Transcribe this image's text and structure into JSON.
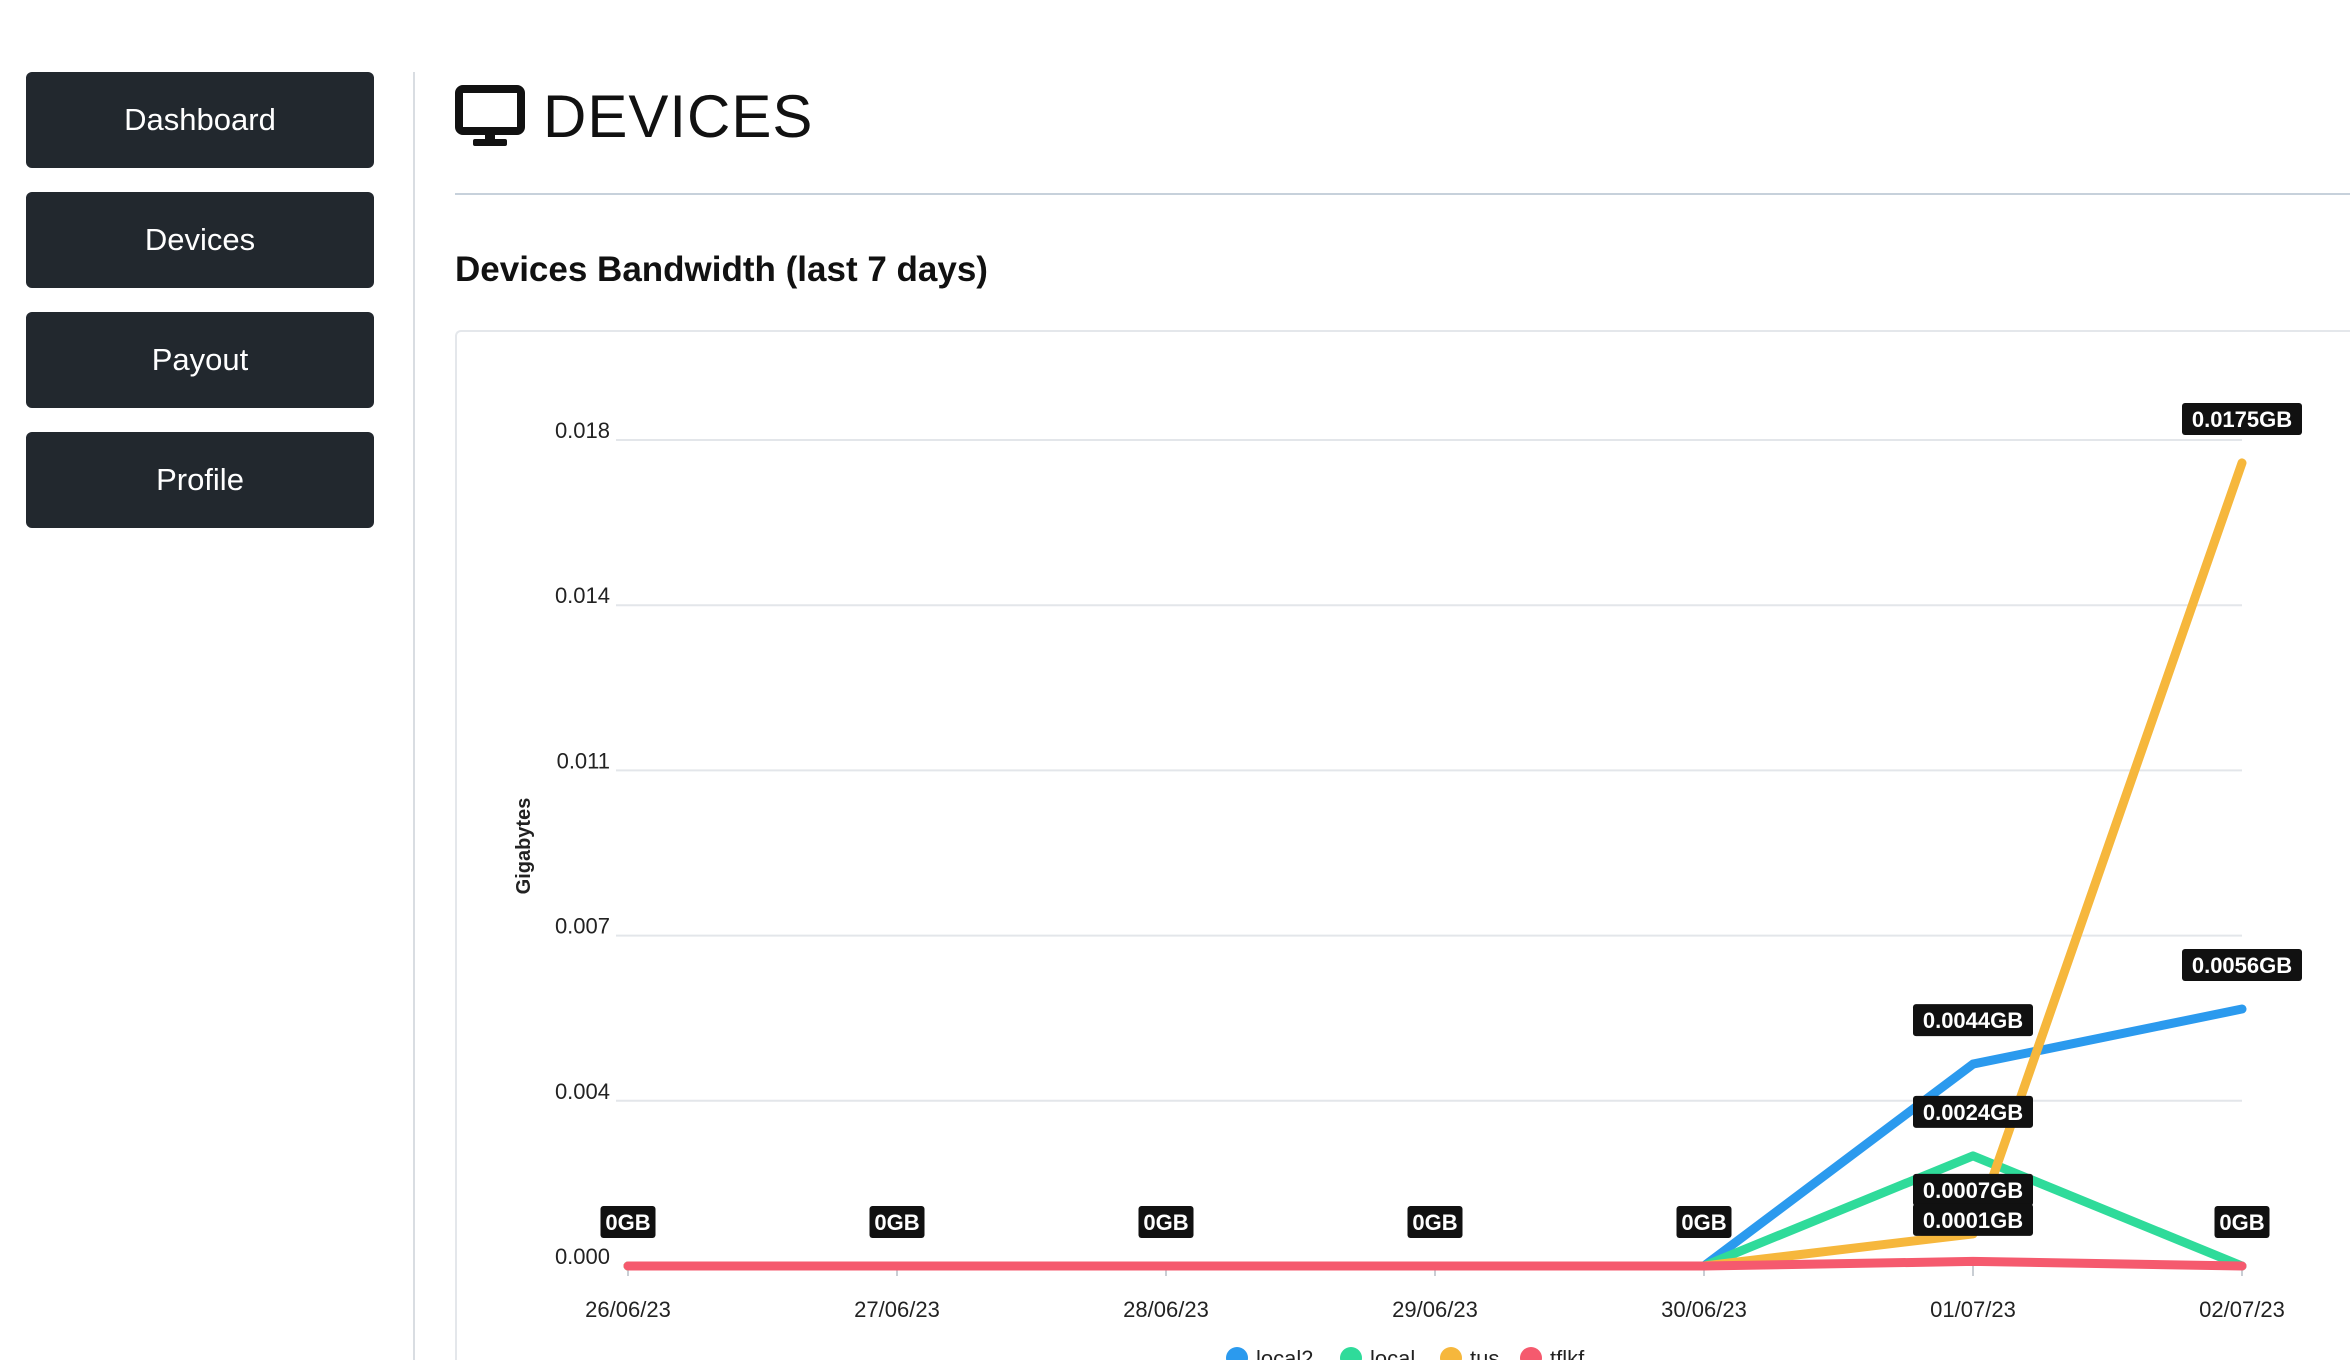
{
  "sidebar": {
    "items": [
      {
        "label": "Dashboard"
      },
      {
        "label": "Devices"
      },
      {
        "label": "Payout"
      },
      {
        "label": "Profile"
      }
    ]
  },
  "header": {
    "title": "DEVICES",
    "icon": "monitor-icon"
  },
  "section": {
    "title": "Devices Bandwidth (last 7 days)"
  },
  "colors": {
    "sidebar_button_bg": "#22282e",
    "sidebar_button_text": "#ffffff",
    "data_label_bg": "#111111"
  },
  "chart_data": {
    "type": "line",
    "ylabel": "Gigabytes",
    "ylim": [
      0,
      0.018
    ],
    "y_ticks": [
      "0.000",
      "0.004",
      "0.007",
      "0.011",
      "0.014",
      "0.018"
    ],
    "categories": [
      "26/06/23",
      "27/06/23",
      "28/06/23",
      "29/06/23",
      "30/06/23",
      "01/07/23",
      "02/07/23"
    ],
    "grid": true,
    "legend_position": "bottom",
    "series": [
      {
        "name": "local2",
        "color": "#2b9aee",
        "values": [
          0,
          0,
          0,
          0,
          0,
          0.0044,
          0.0056
        ]
      },
      {
        "name": "local",
        "color": "#2fdb9a",
        "values": [
          0,
          0,
          0,
          0,
          0,
          0.0024,
          0
        ]
      },
      {
        "name": "tus",
        "color": "#f6b73c",
        "values": [
          0,
          0,
          0,
          0,
          0,
          0.0007,
          0.0175
        ]
      },
      {
        "name": "tflkf",
        "color": "#f55a6e",
        "values": [
          0,
          0,
          0,
          0,
          0,
          0.0001,
          0
        ]
      }
    ],
    "data_labels": [
      {
        "category": "26/06/23",
        "value": 0,
        "text": "0GB"
      },
      {
        "category": "27/06/23",
        "value": 0,
        "text": "0GB"
      },
      {
        "category": "28/06/23",
        "value": 0,
        "text": "0GB"
      },
      {
        "category": "29/06/23",
        "value": 0,
        "text": "0GB"
      },
      {
        "category": "30/06/23",
        "value": 0,
        "text": "0GB"
      },
      {
        "category": "01/07/23",
        "value": 0.0044,
        "text": "0.0044GB"
      },
      {
        "category": "01/07/23",
        "value": 0.0024,
        "text": "0.0024GB"
      },
      {
        "category": "01/07/23",
        "value": 0.0007,
        "text": "0.0007GB"
      },
      {
        "category": "01/07/23",
        "value": 0.0001,
        "text": "0.0001GB"
      },
      {
        "category": "02/07/23",
        "value": 0.0175,
        "text": "0.0175GB"
      },
      {
        "category": "02/07/23",
        "value": 0.0056,
        "text": "0.0056GB"
      },
      {
        "category": "02/07/23",
        "value": 0,
        "text": "0GB"
      }
    ]
  }
}
